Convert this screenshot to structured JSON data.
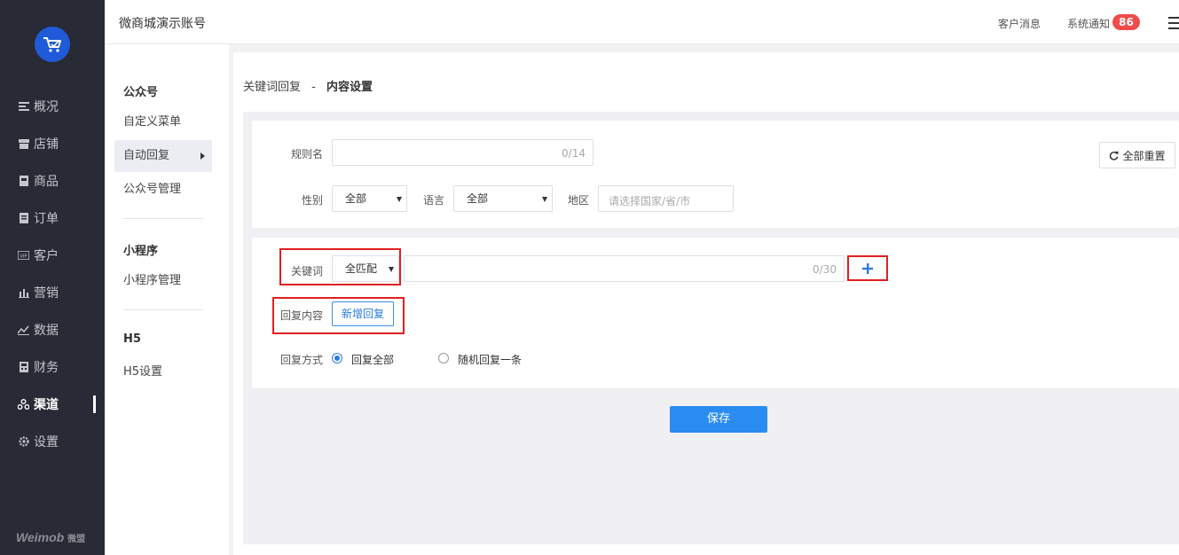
{
  "app": {
    "account_title": "微商城演示账号",
    "brand": "Weimob",
    "brand_cn": "微盟"
  },
  "leftnav": {
    "items": [
      {
        "label": "概况",
        "icon": "list-icon"
      },
      {
        "label": "店铺",
        "icon": "store-icon"
      },
      {
        "label": "商品",
        "icon": "product-icon"
      },
      {
        "label": "订单",
        "icon": "order-icon"
      },
      {
        "label": "客户",
        "icon": "vip-icon"
      },
      {
        "label": "营销",
        "icon": "bar-chart-icon"
      },
      {
        "label": "数据",
        "icon": "line-chart-icon"
      },
      {
        "label": "财务",
        "icon": "calculator-icon"
      },
      {
        "label": "渠道",
        "icon": "channel-icon",
        "active": true
      },
      {
        "label": "设置",
        "icon": "gear-icon"
      }
    ]
  },
  "topbar": {
    "customer_msg": "客户消息",
    "system_notice": "系统通知",
    "notice_count": "86"
  },
  "subnav": {
    "group1_title": "公众号",
    "group1_items": [
      "自定义菜单",
      "自动回复",
      "公众号管理"
    ],
    "group2_title": "小程序",
    "group2_items": [
      "小程序管理"
    ],
    "group3_title": "H5",
    "group3_items": [
      "H5设置"
    ]
  },
  "breadcrumb": {
    "parent": "关键词回复",
    "sep": "-",
    "current": "内容设置"
  },
  "form": {
    "rule_name_label": "规则名",
    "rule_name_value": "",
    "rule_name_count": "0/14",
    "reset_label": "全部重置",
    "gender_label": "性别",
    "gender_value": "全部",
    "language_label": "语言",
    "language_value": "全部",
    "region_label": "地区",
    "region_placeholder": "请选择国家/省/市",
    "keyword_label": "关键词",
    "keyword_match": "全匹配",
    "keyword_value": "",
    "keyword_count": "0/30",
    "reply_content_label": "回复内容",
    "add_reply_label": "新增回复",
    "reply_mode_label": "回复方式",
    "reply_all_label": "回复全部",
    "reply_random_label": "随机回复一条",
    "reply_mode_selected": "回复全部",
    "save_label": "保存"
  },
  "colors": {
    "sidebar_bg": "#282b35",
    "accent": "#2a8cf0",
    "badge": "#f04b4b",
    "highlight_box": "#e02020"
  }
}
